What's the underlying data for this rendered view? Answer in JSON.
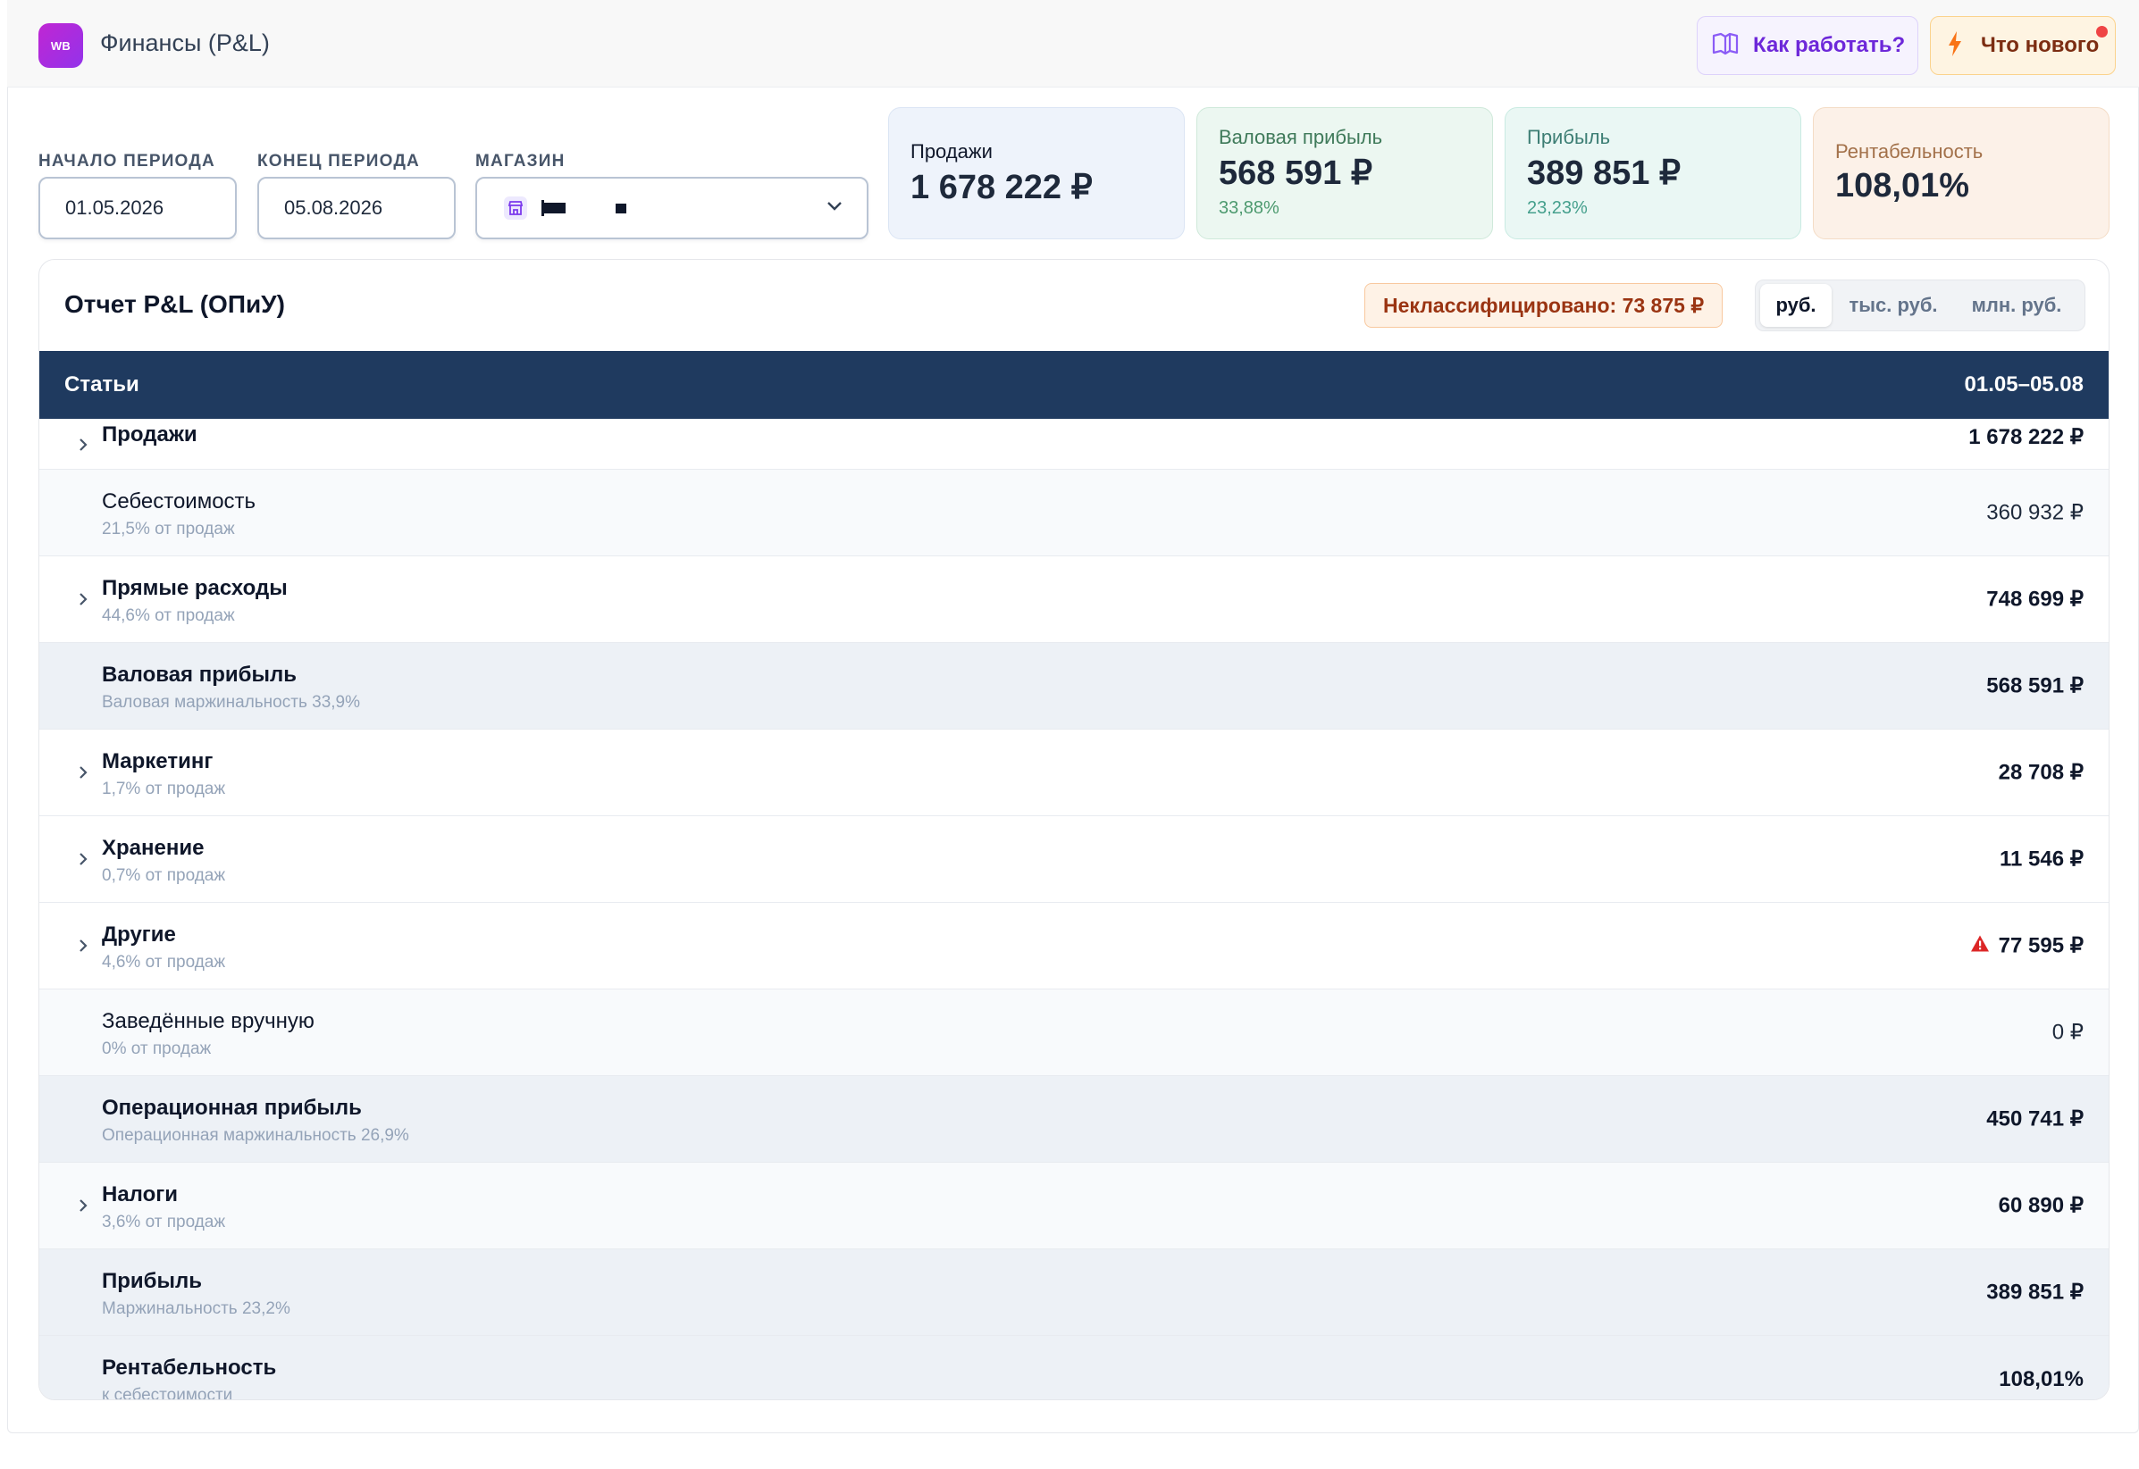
{
  "header": {
    "logo_text": "WB",
    "title": "Финансы (P&L)",
    "how_label": "Как работать?",
    "whats_new_label": "Что нового"
  },
  "filters": {
    "start_label": "НАЧАЛО ПЕРИОДА",
    "start_value": "01.05.2026",
    "end_label": "КОНЕЦ ПЕРИОДА",
    "end_value": "05.08.2026",
    "store_label": "МАГАЗИН"
  },
  "kpis": [
    {
      "label": "Продажи",
      "value": "1 678 222 ₽",
      "sub": ""
    },
    {
      "label": "Валовая прибыль",
      "value": "568 591 ₽",
      "sub": "33,88%"
    },
    {
      "label": "Прибыль",
      "value": "389 851 ₽",
      "sub": "23,23%"
    },
    {
      "label": "Рентабельность",
      "value": "108,01%",
      "sub": ""
    }
  ],
  "report": {
    "title": "Отчет P&L (ОПиУ)",
    "unclassified": "Неклассифицировано: 73 875 ₽",
    "units": [
      "руб.",
      "тыс. руб.",
      "млн. руб."
    ],
    "active_unit": "руб.",
    "col_items": "Статьи",
    "col_period": "01.05–05.08",
    "rows": [
      {
        "name": "Продажи",
        "sub": "",
        "value": "1 678 222 ₽"
      },
      {
        "name": "Себестоимость",
        "sub": "21,5% от продаж",
        "value": "360 932 ₽"
      },
      {
        "name": "Прямые расходы",
        "sub": "44,6% от продаж",
        "value": "748 699 ₽"
      },
      {
        "name": "Валовая прибыль",
        "sub": "Валовая маржинальность 33,9%",
        "value": "568 591 ₽"
      },
      {
        "name": "Маркетинг",
        "sub": "1,7% от продаж",
        "value": "28 708 ₽"
      },
      {
        "name": "Хранение",
        "sub": "0,7% от продаж",
        "value": "11 546 ₽"
      },
      {
        "name": "Другие",
        "sub": "4,6% от продаж",
        "value": "77 595 ₽"
      },
      {
        "name": "Заведённые вручную",
        "sub": "0% от продаж",
        "value": "0 ₽"
      },
      {
        "name": "Операционная прибыль",
        "sub": "Операционная маржинальность 26,9%",
        "value": "450 741 ₽"
      },
      {
        "name": "Налоги",
        "sub": "3,6% от продаж",
        "value": "60 890 ₽"
      },
      {
        "name": "Прибыль",
        "sub": "Маржинальность 23,2%",
        "value": "389 851 ₽"
      },
      {
        "name": "Рентабельность",
        "sub": "к себестоимости",
        "value": "108,01%"
      }
    ]
  },
  "icons": {
    "book": "book-icon",
    "bolt": "lightning-icon",
    "store": "store-icon",
    "chevron_down": "chevron-down-icon",
    "chevron_right": "chevron-right-icon",
    "warning": "warning-icon"
  },
  "colors": {
    "table_header": "#1f3a5f",
    "accent_purple": "#6d28d9",
    "warning_red": "#dc2626"
  }
}
